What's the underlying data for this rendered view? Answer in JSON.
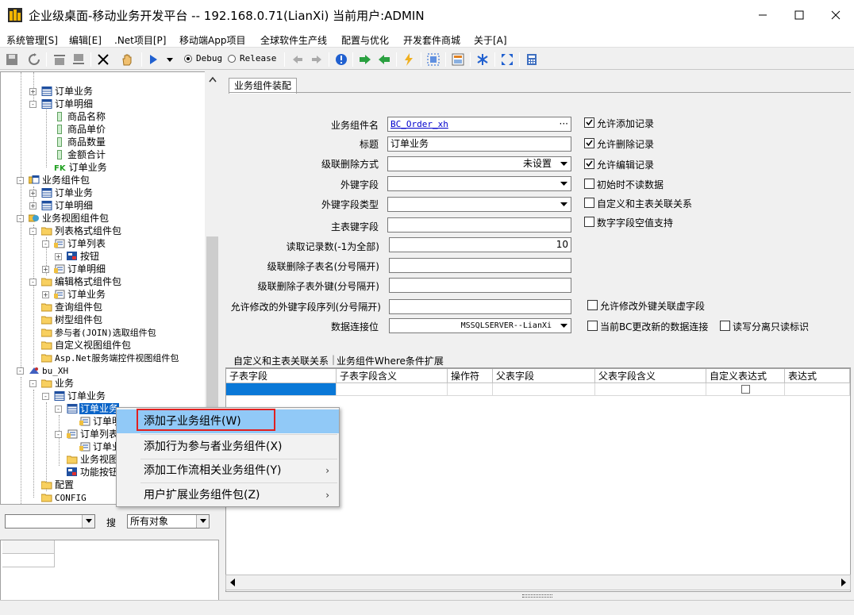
{
  "window": {
    "title": "企业级桌面-移动业务开发平台 -- 192.168.0.71(LianXi) 当前用户:ADMIN"
  },
  "menu": [
    "系统管理[S]",
    "编辑[E]",
    ".Net项目[P]",
    "移动端App项目",
    "全球软件生产线",
    "配置与优化",
    "开发套件商城",
    "关于[A]"
  ],
  "toolbar": {
    "debug_label": "Debug",
    "release_label": "Release",
    "selected_mode": "Debug"
  },
  "tree": {
    "items": [
      {
        "label": "订单业务",
        "icon": "table-icon"
      },
      {
        "label": "订单明细",
        "icon": "table-icon"
      },
      {
        "label": "商品名称",
        "icon": "field-icon"
      },
      {
        "label": "商品单价",
        "icon": "field-icon"
      },
      {
        "label": "商品数量",
        "icon": "field-icon"
      },
      {
        "label": "金额合计",
        "icon": "field-icon"
      },
      {
        "label": "FK",
        "icon": "fk-badge"
      },
      {
        "label": "订单业务",
        "icon": "fk-icon"
      },
      {
        "label": "业务组件包",
        "icon": "package-icon"
      },
      {
        "label": "订单业务",
        "icon": "table-icon"
      },
      {
        "label": "订单明细",
        "icon": "table-icon"
      },
      {
        "label": "业务视图组件包",
        "icon": "view-package-icon"
      },
      {
        "label": "列表格式组件包",
        "icon": "folder-icon"
      },
      {
        "label": "订单列表",
        "icon": "list-icon"
      },
      {
        "label": "按钮",
        "icon": "button-icon"
      },
      {
        "label": "订单明细",
        "icon": "list-icon"
      },
      {
        "label": "编辑格式组件包",
        "icon": "folder-icon"
      },
      {
        "label": "订单业务",
        "icon": "list-icon"
      },
      {
        "label": "查询组件包",
        "icon": "folder-icon"
      },
      {
        "label": "树型组件包",
        "icon": "folder-icon"
      },
      {
        "label": "参与者(JOIN)选取组件包",
        "icon": "folder-icon"
      },
      {
        "label": "自定义视图组件包",
        "icon": "folder-icon"
      },
      {
        "label": "Asp.Net服务端控件视图组件包",
        "icon": "folder-icon"
      },
      {
        "label": "bu_XH",
        "icon": "project-icon"
      },
      {
        "label": "业务",
        "icon": "folder-icon"
      },
      {
        "label": "订单业务",
        "icon": "table-icon"
      },
      {
        "label": "订单业务",
        "icon": "table-icon"
      },
      {
        "label": "订单明",
        "icon": "list-icon"
      },
      {
        "label": "订单列表",
        "icon": "list-icon"
      },
      {
        "label": "订单业",
        "icon": "list-icon"
      },
      {
        "label": "业务视图",
        "icon": "folder-icon"
      },
      {
        "label": "功能按钮",
        "icon": "button-icon"
      },
      {
        "label": "配置",
        "icon": "folder-icon"
      },
      {
        "label": "CONFIG",
        "icon": "folder-icon"
      }
    ]
  },
  "left_bottom": {
    "search_label": "搜",
    "scope_value": "所有对象",
    "type_value": ""
  },
  "tab_title": "业务组件装配",
  "form": {
    "component_name_label": "业务组件名",
    "component_name_value": "BC_Order_xh",
    "title_label": "标题",
    "title_value": "订单业务",
    "cascade_delete_label": "级联删除方式",
    "cascade_delete_value": "未设置",
    "fk_field_label": "外键字段",
    "fk_field_value": "",
    "fk_type_label": "外键字段类型",
    "fk_type_value": "",
    "pk_label": "主表键字段",
    "pk_value": "",
    "read_count_label": "读取记录数(-1为全部)",
    "read_count_value": "10",
    "cascade_child_tables_label": "级联删除子表名(分号隔开)",
    "cascade_child_fk_label": "级联删除子表外键(分号隔开)",
    "editable_fk_label": "允许修改的外键字段序列(分号隔开)",
    "datasource_label": "数据连接位",
    "datasource_value": "MSSQLSERVER--LianXi",
    "checks": [
      {
        "label": "允许添加记录",
        "checked": true
      },
      {
        "label": "允许删除记录",
        "checked": true
      },
      {
        "label": "允许编辑记录",
        "checked": true
      },
      {
        "label": "初始时不读数据",
        "checked": false
      },
      {
        "label": "自定义和主表关联关系",
        "checked": false
      },
      {
        "label": "数字字段空值支持",
        "checked": false
      }
    ],
    "check_allow_fk_virtual": "允许修改外键关联虚字段",
    "check_update_conn": "当前BC更改新的数据连接",
    "check_read_separate": "读写分离只读标识"
  },
  "lower_tabs": [
    "自定义和主表关联关系",
    "业务组件Where条件扩展"
  ],
  "grid": {
    "columns": [
      "子表字段",
      "子表字段含义",
      "操作符",
      "父表字段",
      "父表字段含义",
      "自定义表达式",
      "表达式"
    ]
  },
  "context_menu": {
    "items": [
      {
        "label": "添加子业务组件(W)",
        "submenu": false
      },
      {
        "label": "添加行为参与者业务组件(X)",
        "submenu": false
      },
      {
        "label": "添加工作流相关业务组件(Y)",
        "submenu": true
      },
      {
        "label": "用户扩展业务组件包(Z)",
        "submenu": true
      }
    ]
  },
  "colors": {
    "selection": "#0a64c8",
    "menu_highlight": "#91c9f7",
    "highlight_box": "#e02020",
    "link_text": "#0000cc"
  }
}
